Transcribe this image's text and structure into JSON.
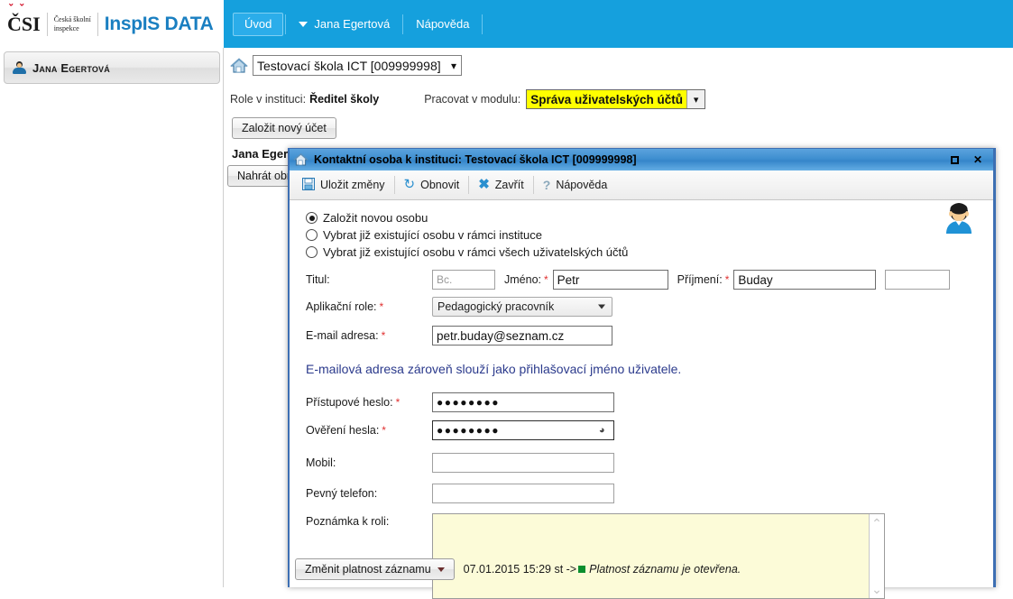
{
  "header": {
    "logo_abbrev": "ČSI",
    "logo_sub_line1": "Česká školní",
    "logo_sub_line2": "inspekce",
    "app_name": "InspIS DATA",
    "nav_items": [
      {
        "label": "Úvod",
        "name": "nav-tab-uvod",
        "active": true
      },
      {
        "label": "Jana Egertová",
        "name": "nav-tab-user",
        "active": false
      },
      {
        "label": "Nápověda",
        "name": "nav-tab-help",
        "active": false
      }
    ]
  },
  "sidebar": {
    "user_name": "Jana Egertová",
    "user_icon": "user-avatar-icon"
  },
  "main": {
    "institution_icon": "home-institution-icon",
    "institution_value": "Testovací škola ICT [009999998]",
    "role_label": "Role v instituci:",
    "role_value": "Ředitel školy",
    "module_label": "Pracovat v modulu:",
    "module_value": "Správa uživatelských účtů",
    "new_account_button": "Založit nový účet",
    "person_heading": "Jana Egertová",
    "upload_button": "Nahrát obrázek"
  },
  "dialog": {
    "title": "Kontaktní osoba k instituci: Testovací škola ICT [009999998]",
    "title_icon": "home-institution-icon",
    "maximize_icon": "maximize-icon",
    "close_icon": "close-icon",
    "avatar_icon": "user-avatar-large-icon",
    "toolbar": [
      {
        "label": "Uložit změny",
        "icon": "save-icon",
        "name": "save-changes-button"
      },
      {
        "label": "Obnovit",
        "icon": "refresh-icon",
        "name": "refresh-button"
      },
      {
        "label": "Zavřít",
        "icon": "close-x-icon",
        "name": "close-button"
      },
      {
        "label": "Nápověda",
        "icon": "help-question-icon",
        "name": "help-button"
      }
    ],
    "radios": [
      {
        "label": "Založit novou osobu",
        "selected": true,
        "name": "radio-new-person"
      },
      {
        "label": "Vybrat již existující osobu v rámci instituce",
        "selected": false,
        "name": "radio-existing-in-institution"
      },
      {
        "label": "Vybrat již existující osobu v rámci všech uživatelských účtů",
        "selected": false,
        "name": "radio-existing-all-accounts"
      }
    ],
    "fields": {
      "titul_label": "Titul:",
      "titul_value": "Bc.",
      "jmeno_label": "Jméno:",
      "jmeno_value": "Petr",
      "prijmeni_label": "Příjmení:",
      "prijmeni_value": "Buday",
      "titul_za_value": "",
      "app_role_label": "Aplikační role:",
      "app_role_value": "Pedagogický pracovník",
      "email_label": "E-mail adresa:",
      "email_value": "petr.buday@seznam.cz",
      "email_note": "E-mailová adresa zároveň slouží jako přihlašovací jméno uživatele.",
      "password_label": "Přístupové heslo:",
      "password_value": "●●●●●●●●",
      "password_confirm_label": "Ověření hesla:",
      "password_confirm_value": "●●●●●●●●",
      "reveal_icon": "reveal-password-icon",
      "mobile_label": "Mobil:",
      "mobile_value": "",
      "phone_label": "Pevný telefon:",
      "phone_value": "",
      "note_label": "Poznámka k roli:",
      "note_value": ""
    },
    "footer": {
      "validity_button": "Změnit platnost záznamu",
      "validity_timestamp": "07.01.2015 15:29 st ->",
      "validity_status": "Platnost záznamu je otevřena.",
      "status_marker_color": "#0a8f2e"
    }
  },
  "colors": {
    "nav_blue": "#15a0dd",
    "brand_blue": "#1a7fc1",
    "highlight_yellow": "#ffff00",
    "note_yellow": "#fcfbd8",
    "dialog_blue": "#3f8fd0",
    "required_red": "#e03030",
    "note_text_blue": "#2b3a8c"
  }
}
